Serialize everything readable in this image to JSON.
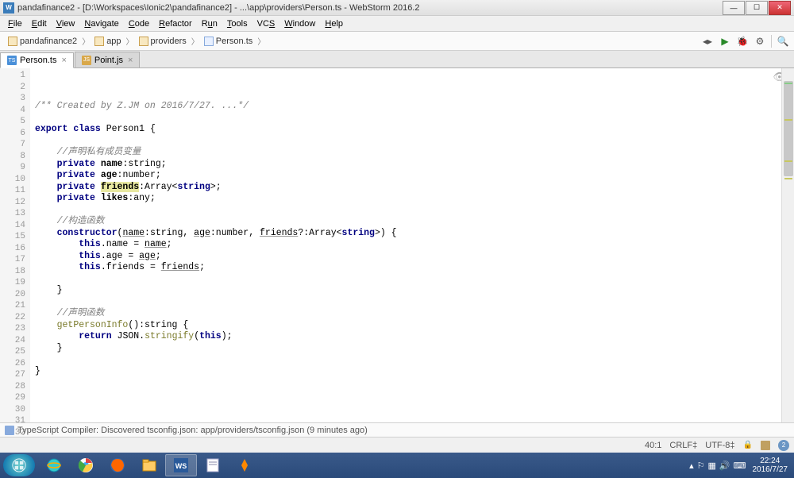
{
  "window": {
    "title": "pandafinance2 - [D:\\Workspaces\\Ionic2\\pandafinance2] - ...\\app\\providers\\Person.ts - WebStorm 2016.2"
  },
  "menus": [
    "File",
    "Edit",
    "View",
    "Navigate",
    "Code",
    "Refactor",
    "Run",
    "Tools",
    "VCS",
    "Window",
    "Help"
  ],
  "breadcrumbs": [
    {
      "label": "pandafinance2",
      "type": "folder"
    },
    {
      "label": "app",
      "type": "folder"
    },
    {
      "label": "providers",
      "type": "folder"
    },
    {
      "label": "Person.ts",
      "type": "file"
    }
  ],
  "tabs": [
    {
      "label": "Person.ts",
      "icon": "ts",
      "active": true
    },
    {
      "label": "Point.js",
      "icon": "js",
      "active": false
    }
  ],
  "code": {
    "lines": 32,
    "l1_pre": "/** Created by Z.JM on 2016/7/27. ...*/",
    "l3_kw1": "export",
    "l3_kw2": "class",
    "l3_name": "Person1",
    "l3_br": " {",
    "l5_cm": "//声明私有成员变量",
    "l6_kw": "private",
    "l6_name": "name",
    "l6_ty": ":string;",
    "l7_kw": "private",
    "l7_name": "age",
    "l7_ty": ":number;",
    "l8_kw": "private",
    "l8_name": "friends",
    "l8_ty1": ":Array<",
    "l8_ty2": "string",
    "l8_ty3": ">;",
    "l9_kw": "private",
    "l9_name": "likes",
    "l9_ty": ":any;",
    "l11_cm": "//构造函数",
    "l12_kw": "constructor",
    "l12_p": "(",
    "l12_a1": "name",
    "l12_t1": ":string, ",
    "l12_a2": "age",
    "l12_t2": ":number, ",
    "l12_a3": "friends",
    "l12_t3": "?:Array<",
    "l12_ts": "string",
    "l12_t4": ">) {",
    "l13_this": "this",
    "l13_rest": ".name = ",
    "l13_v": "name",
    "l13_e": ";",
    "l14_this": "this",
    "l14_rest": ".age = ",
    "l14_v": "age",
    "l14_e": ";",
    "l15_this": "this",
    "l15_rest": ".friends = ",
    "l15_v": "friends",
    "l15_e": ";",
    "l17_br": "}",
    "l19_cm": "//声明函数",
    "l20_fn": "getPersonInfo",
    "l20_sig": "():string {",
    "l21_kw": "return",
    "l21_json": " JSON.",
    "l21_m": "stringify",
    "l21_p": "(",
    "l21_this": "this",
    "l21_e": ");",
    "l22_br": "}",
    "l24_br": "}"
  },
  "message_bar": {
    "text": "TypeScript Compiler: Discovered tsconfig.json: app/providers/tsconfig.json (9 minutes ago)"
  },
  "status": {
    "pos": "40:1",
    "line_ending": "CRLF",
    "encoding": "UTF-8",
    "badge": "2"
  },
  "taskbar": {
    "time": "22:24",
    "date": "2016/7/27"
  }
}
